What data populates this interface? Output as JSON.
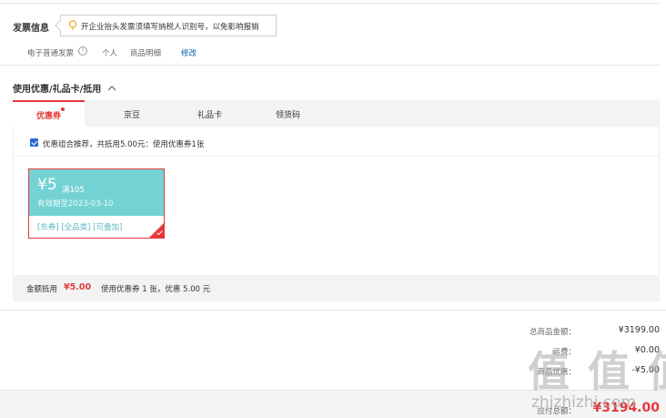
{
  "invoice": {
    "title": "发票信息",
    "tip": "开企业抬头发票须填写纳税人识别号，以免影响报销",
    "type": "电子普通发票",
    "holder": "个人",
    "content": "商品明细",
    "edit_label": "修改"
  },
  "discount": {
    "title": "使用优惠/礼品卡/抵用",
    "tabs": [
      {
        "label": "优惠券"
      },
      {
        "label": "京豆"
      },
      {
        "label": "礼品卡"
      },
      {
        "label": "领货码"
      }
    ],
    "recommend_text": "优惠组合推荐，共抵用5.00元：使用优惠券1张",
    "coupon": {
      "amount": "¥5",
      "condition": "满105",
      "expiry": "有效期至2023-03-10",
      "tags": "[东券]  [全品类]  [可叠加]"
    },
    "summary_label": "金额抵用",
    "summary_amount": "¥5.00",
    "summary_detail": "使用优惠券 1 张，优惠 5.00 元"
  },
  "totals": {
    "items_total_label": "总商品金额：",
    "items_total": "¥3199.00",
    "row2_label": "运费：",
    "row2_value": "¥0.00",
    "row3_label": "商品优惠：",
    "row3_value": "-¥5.00",
    "pay_label": "应付总额：",
    "pay_value": "¥3194.00"
  },
  "watermark": {
    "glyphs": "值 值 值",
    "url": "zhizhizhi.com"
  },
  "colors": {
    "accent_red": "#e4393c",
    "link_blue": "#005ea7",
    "coupon_teal": "#74d2d4"
  }
}
